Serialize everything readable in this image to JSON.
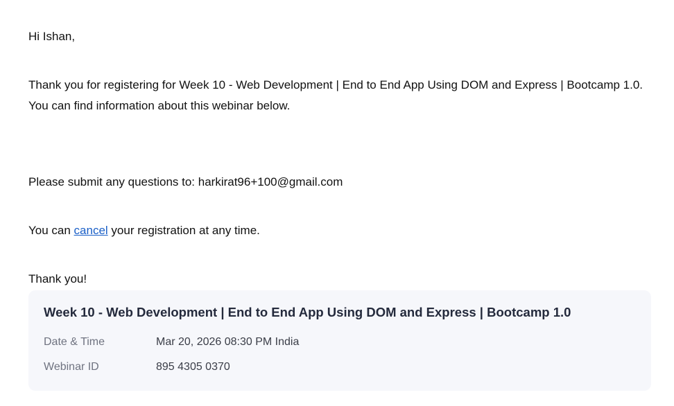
{
  "email": {
    "greeting": "Hi Ishan,",
    "intro": "Thank you for registering for Week 10 - Web Development | End to End App Using DOM and Express | Bootcamp 1.0. You can find information about this webinar below.",
    "questions": "Please submit any questions to: harkirat96+100@gmail.com",
    "cancel_prefix": "You can ",
    "cancel_link": "cancel",
    "cancel_suffix": " your registration at any time.",
    "closing": "Thank you!"
  },
  "webinar_card": {
    "title": "Week 10 - Web Development | End to End App Using DOM and Express | Bootcamp 1.0",
    "rows": [
      {
        "label": "Date & Time",
        "value": "Mar 20, 2026 08:30 PM India"
      },
      {
        "label": "Webinar ID",
        "value": "895 4305 0370"
      }
    ]
  }
}
